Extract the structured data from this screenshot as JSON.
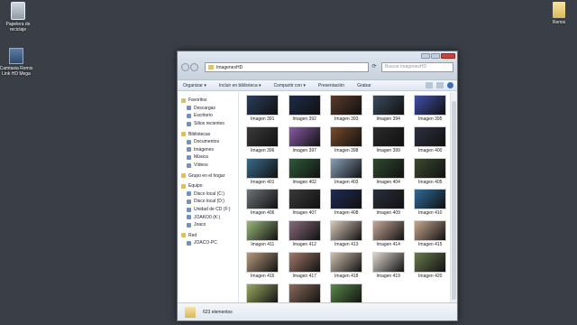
{
  "desktop": {
    "icons": [
      {
        "label": "Papelera de reciclaje",
        "icon": "recycle-bin-icon"
      },
      {
        "label": "Camtasia Remix Link HD Mega",
        "icon": "shortcut-icon"
      },
      {
        "label": "Remix",
        "icon": "folder-icon"
      }
    ]
  },
  "window": {
    "path": "ImagenesHD",
    "search_placeholder": "Buscar ImagenesHD",
    "toolbar": {
      "organize": "Organizar ▾",
      "include": "Incluir en biblioteca ▾",
      "share": "Compartir con ▾",
      "slideshow": "Presentación",
      "burn": "Grabar"
    },
    "nav": [
      {
        "label": "Favoritos",
        "group": true
      },
      {
        "label": "Descargas",
        "group": false
      },
      {
        "label": "Escritorio",
        "group": false
      },
      {
        "label": "Sitios recientes",
        "group": false
      },
      {
        "label": "Bibliotecas",
        "group": true
      },
      {
        "label": "Documentos",
        "group": false
      },
      {
        "label": "Imágenes",
        "group": false
      },
      {
        "label": "Música",
        "group": false
      },
      {
        "label": "Vídeos",
        "group": false
      },
      {
        "label": "Grupo en el hogar",
        "group": true
      },
      {
        "label": "Equipo",
        "group": true
      },
      {
        "label": "Disco local (C:)",
        "group": false
      },
      {
        "label": "Disco local (D:)",
        "group": false
      },
      {
        "label": "Unidad de CD (F:)",
        "group": false
      },
      {
        "label": "JOAKO0 (K:)",
        "group": false
      },
      {
        "label": "Joaco",
        "group": false
      },
      {
        "label": "Red",
        "group": true
      },
      {
        "label": "JOACO-PC",
        "group": false
      }
    ],
    "files": [
      {
        "name": "Imagen 391",
        "color": "#2a3d5c"
      },
      {
        "name": "Imagen 392",
        "color": "#1d2b4a"
      },
      {
        "name": "Imagen 393",
        "color": "#5a3a2c"
      },
      {
        "name": "Imagen 394",
        "color": "#3b4a5e"
      },
      {
        "name": "Imagen 395",
        "color": "#4050a8"
      },
      {
        "name": "Imagen 396",
        "color": "#3a3a3a"
      },
      {
        "name": "Imagen 397",
        "color": "#8a5aa8"
      },
      {
        "name": "Imagen 398",
        "color": "#7a4a2a"
      },
      {
        "name": "Imagen 399",
        "color": "#2a2a2a"
      },
      {
        "name": "Imagen 400",
        "color": "#2d3140"
      },
      {
        "name": "Imagen 401",
        "color": "#3a6a8a"
      },
      {
        "name": "Imagen 402",
        "color": "#2f5a3a"
      },
      {
        "name": "Imagen 403",
        "color": "#8aa0b8"
      },
      {
        "name": "Imagen 404",
        "color": "#2f4a2f"
      },
      {
        "name": "Imagen 405",
        "color": "#3c4a30"
      },
      {
        "name": "Imagen 406",
        "color": "#6e7378"
      },
      {
        "name": "Imagen 407",
        "color": "#3a3a3a"
      },
      {
        "name": "Imagen 408",
        "color": "#1f2a55"
      },
      {
        "name": "Imagen 409",
        "color": "#2a2f3a"
      },
      {
        "name": "Imagen 410",
        "color": "#2f6a9a"
      },
      {
        "name": "Imagen 411",
        "color": "#9ab87a"
      },
      {
        "name": "Imagen 412",
        "color": "#8a6a7a"
      },
      {
        "name": "Imagen 413",
        "color": "#d8c8b8"
      },
      {
        "name": "Imagen 414",
        "color": "#c8a898"
      },
      {
        "name": "Imagen 415",
        "color": "#c8a890"
      },
      {
        "name": "Imagen 416",
        "color": "#b89a80"
      },
      {
        "name": "Imagen 417",
        "color": "#a07a6a"
      },
      {
        "name": "Imagen 418",
        "color": "#d0c0b0"
      },
      {
        "name": "Imagen 419",
        "color": "#e0d8d0"
      },
      {
        "name": "Imagen 420",
        "color": "#6a7a50"
      },
      {
        "name": "Imagen 421",
        "color": "#98a860"
      },
      {
        "name": "Imagen 422",
        "color": "#8a6a5a"
      },
      {
        "name": "Imagen 423",
        "color": "#5a8a4a"
      }
    ],
    "status": "623 elementos"
  }
}
